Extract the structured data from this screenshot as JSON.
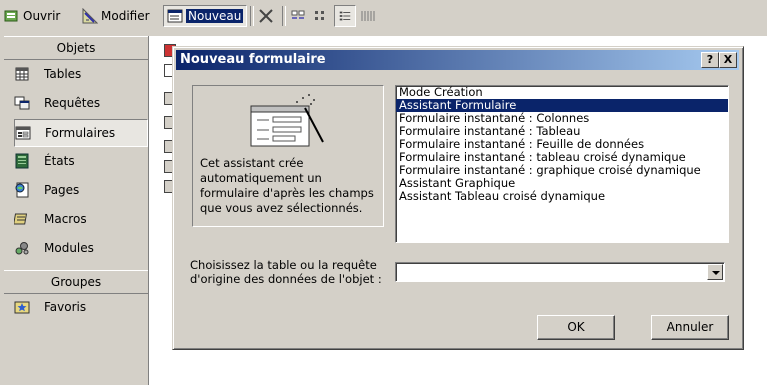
{
  "toolbar": {
    "open_label": "Ouvrir",
    "modify_label": "Modifier",
    "new_label": "Nouveau"
  },
  "objects_bar": {
    "objects_header": "Objets",
    "items": [
      {
        "label": "Tables",
        "icon": "table-icon"
      },
      {
        "label": "Requêtes",
        "icon": "query-icon"
      },
      {
        "label": "Formulaires",
        "icon": "form-icon"
      },
      {
        "label": "États",
        "icon": "report-icon"
      },
      {
        "label": "Pages",
        "icon": "page-icon"
      },
      {
        "label": "Macros",
        "icon": "macro-icon"
      },
      {
        "label": "Modules",
        "icon": "module-icon"
      }
    ],
    "selected": "Formulaires",
    "groups_header": "Groupes",
    "group_items": [
      {
        "label": "Favoris",
        "icon": "favorites-icon"
      }
    ]
  },
  "dialog": {
    "title": "Nouveau formulaire",
    "help_button": "?",
    "close_button": "X",
    "description": "Cet assistant crée automatiquement un formulaire d'après les champs que vous avez sélectionnés.",
    "options": [
      "Mode Création",
      "Assistant Formulaire",
      "Formulaire instantané : Colonnes",
      "Formulaire instantané : Tableau",
      "Formulaire instantané : Feuille de données",
      "Formulaire instantané : tableau croisé dynamique",
      "Formulaire instantané : graphique croisé dynamique",
      "Assistant Graphique",
      "Assistant Tableau croisé dynamique"
    ],
    "selected_option": "Assistant Formulaire",
    "source_label": "Choisissez la table ou la requête d'origine des données de l'objet :",
    "source_value": "",
    "ok_label": "OK",
    "cancel_label": "Annuler"
  },
  "colors": {
    "face": "#d4d0c8",
    "selection": "#0a246a",
    "title_gradient_end": "#a6caf0"
  }
}
